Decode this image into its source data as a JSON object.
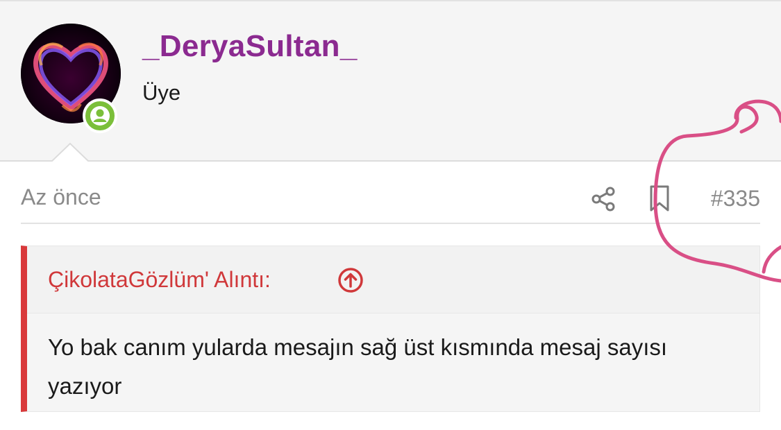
{
  "user": {
    "username": "_DeryaSultan_",
    "title": "Üye",
    "online": true
  },
  "post": {
    "time": "Az önce",
    "number": "#335",
    "actions": [
      "share-icon",
      "bookmark-icon"
    ]
  },
  "quote": {
    "author_label": "ÇikolataGözlüm' Alıntı:",
    "body": "Yo bak canım yularda mesajın sağ üst kısmında mesaj sayısı yazıyor"
  },
  "colors": {
    "username": "#8b2a90",
    "quote_accent": "#d9393b",
    "online": "#7bbf3a",
    "annotation": "#d94f86"
  }
}
